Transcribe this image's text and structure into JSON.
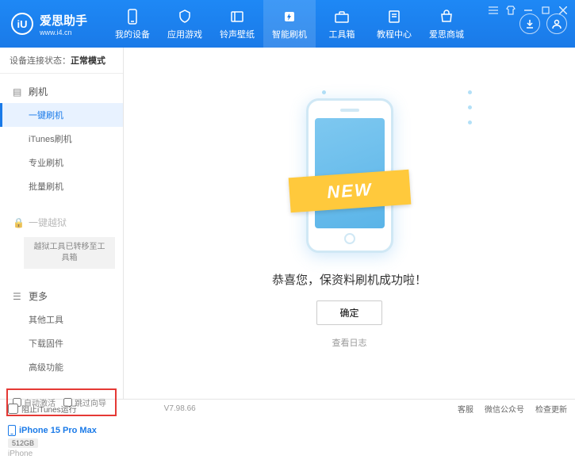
{
  "logo": {
    "badge": "iU",
    "title": "爱思助手",
    "subtitle": "www.i4.cn"
  },
  "nav": [
    {
      "label": "我的设备"
    },
    {
      "label": "应用游戏"
    },
    {
      "label": "铃声壁纸"
    },
    {
      "label": "智能刷机"
    },
    {
      "label": "工具箱"
    },
    {
      "label": "教程中心"
    },
    {
      "label": "爱思商城"
    }
  ],
  "conn": {
    "prefix": "设备连接状态：",
    "status": "正常模式"
  },
  "sidebar": {
    "group1": {
      "header": "刷机",
      "items": [
        "一键刷机",
        "iTunes刷机",
        "专业刷机",
        "批量刷机"
      ]
    },
    "group2": {
      "header": "一键越狱",
      "note": "越狱工具已转移至工具箱"
    },
    "group3": {
      "header": "更多",
      "items": [
        "其他工具",
        "下载固件",
        "高级功能"
      ]
    }
  },
  "opts": {
    "auto_activate": "自动激活",
    "skip_guide": "跳过向导"
  },
  "device": {
    "name": "iPhone 15 Pro Max",
    "storage": "512GB",
    "type": "iPhone"
  },
  "main": {
    "ribbon": "NEW",
    "message": "恭喜您，保资料刷机成功啦！",
    "ok": "确定",
    "log": "查看日志"
  },
  "footer": {
    "block_itunes": "阻止iTunes运行",
    "version": "V7.98.66",
    "links": [
      "客服",
      "微信公众号",
      "检查更新"
    ]
  }
}
